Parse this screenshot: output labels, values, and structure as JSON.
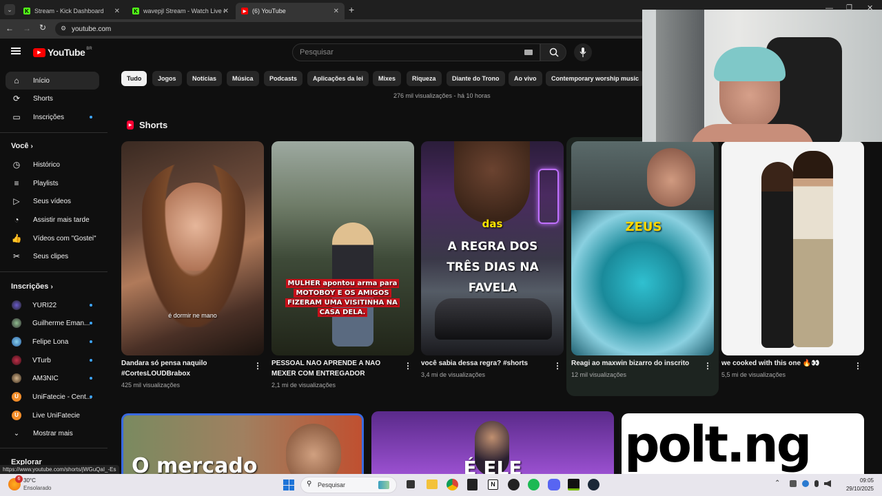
{
  "browser": {
    "tabs": [
      {
        "title": "Stream - Kick Dashboard"
      },
      {
        "title": "wavepjl Stream - Watch Live on"
      },
      {
        "title": "(6) YouTube"
      }
    ],
    "url": "youtube.com",
    "status_url": "https://www.youtube.com/shorts/jWGuQaI_-Es"
  },
  "youtube": {
    "logo": "YouTube",
    "region": "BR",
    "search_placeholder": "Pesquisar",
    "main_nav": [
      {
        "label": "Início"
      },
      {
        "label": "Shorts"
      },
      {
        "label": "Inscrições"
      }
    ],
    "you_heading": "Você",
    "you_items": [
      {
        "label": "Histórico"
      },
      {
        "label": "Playlists"
      },
      {
        "label": "Seus vídeos"
      },
      {
        "label": "Assistir mais tarde"
      },
      {
        "label": "Vídeos com \"Gostei\""
      },
      {
        "label": "Seus clipes"
      }
    ],
    "subs_heading": "Inscrições",
    "subscriptions": [
      {
        "label": "YURI22"
      },
      {
        "label": "Guilherme Eman..."
      },
      {
        "label": "Felipe Lona"
      },
      {
        "label": "VTurb"
      },
      {
        "label": "AM3NIC"
      },
      {
        "label": "UniFatecie - Cent..."
      },
      {
        "label": "Live UniFatecie"
      },
      {
        "label": "Mostrar mais"
      }
    ],
    "explore_heading": "Explorar",
    "chips": [
      "Tudo",
      "Jogos",
      "Notícias",
      "Música",
      "Podcasts",
      "Aplicações da lei",
      "Mixes",
      "Riqueza",
      "Diante do Trono",
      "Ao vivo",
      "Contemporary worship music"
    ],
    "prev_meta": "276 mil visualizações - há 10 horas",
    "shorts_heading": "Shorts",
    "shorts": [
      {
        "title": "Dandara só pensa naquilo #CortesLOUDBrabox",
        "views": "425 mil visualizações",
        "caption": "é dormir ne mano"
      },
      {
        "title": "PESSOAL NAO APRENDE A NAO MEXER COM ENTREGADOR",
        "views": "2,1 mi de visualizações",
        "caption": "MULHER apontou arma para MOTOBOY E OS AMIGOS FIZERAM UMA VISITINHA NA CASA DELA."
      },
      {
        "title": "você sabia dessa regra? #shorts",
        "views": "3,4 mi de visualizações",
        "caption_small": "das",
        "caption": "A REGRA DOS TRÊS DIAS NA FAVELA"
      },
      {
        "title": "Reagi ao maxwin bizarro do inscrito",
        "views": "12 mil visualizações",
        "caption": "ZEUS"
      },
      {
        "title": "we cooked with this one 🔥👀",
        "views": "5,5 mi de visualizações"
      }
    ],
    "videos": [
      {
        "overlay": "O mercado"
      },
      {
        "overlay": "É ELE"
      },
      {
        "overlay": "polt.ng"
      }
    ]
  },
  "taskbar": {
    "weather_temp": "30°C",
    "weather_desc": "Ensolarado",
    "weather_badge": "6",
    "search_label": "Pesquisar",
    "time": "09:05",
    "date": "29/10/2025"
  },
  "colors": {
    "accent": "#ff0000",
    "subscription_dot": "#3ea6ff",
    "kick_green": "#53fc18"
  }
}
